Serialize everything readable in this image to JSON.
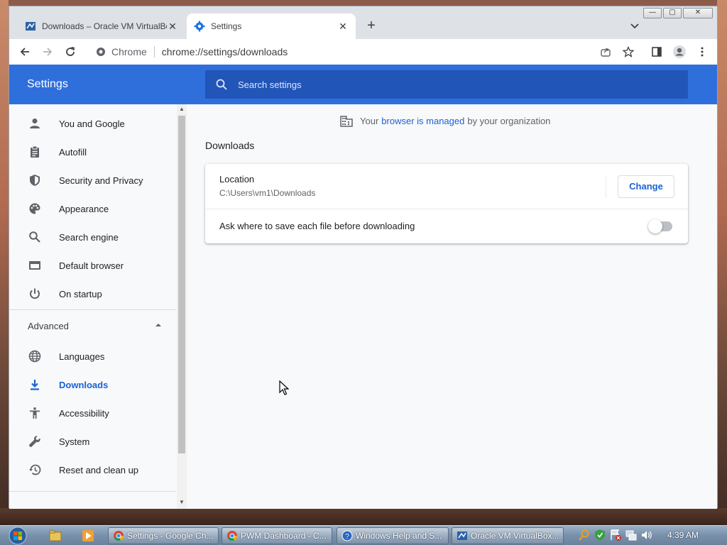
{
  "browser": {
    "tabs": [
      {
        "label": "Downloads – Oracle VM VirtualBox",
        "active": false
      },
      {
        "label": "Settings",
        "active": true
      }
    ],
    "window_controls": {
      "minimize": "—",
      "maximize": "▢",
      "close": "✕"
    },
    "omnibox": {
      "site": "Chrome",
      "url": "chrome://settings/downloads"
    }
  },
  "settings": {
    "title": "Settings",
    "search_placeholder": "Search settings",
    "managed_notice": {
      "prefix": "Your",
      "link": "browser is managed",
      "suffix": "by your organization"
    },
    "nav": [
      {
        "label": "You and Google",
        "icon": "person-icon"
      },
      {
        "label": "Autofill",
        "icon": "clipboard-icon"
      },
      {
        "label": "Security and Privacy",
        "icon": "shield-icon"
      },
      {
        "label": "Appearance",
        "icon": "palette-icon"
      },
      {
        "label": "Search engine",
        "icon": "search-icon"
      },
      {
        "label": "Default browser",
        "icon": "browser-window-icon"
      },
      {
        "label": "On startup",
        "icon": "power-icon"
      }
    ],
    "advanced_label": "Advanced",
    "advanced_nav": [
      {
        "label": "Languages",
        "icon": "globe-icon"
      },
      {
        "label": "Downloads",
        "icon": "download-icon",
        "selected": true
      },
      {
        "label": "Accessibility",
        "icon": "accessibility-icon"
      },
      {
        "label": "System",
        "icon": "wrench-icon"
      },
      {
        "label": "Reset and clean up",
        "icon": "restore-icon"
      }
    ],
    "section_title": "Downloads",
    "location_label": "Location",
    "location_value": "C:\\Users\\vm1\\Downloads",
    "change_button": "Change",
    "ask_label": "Ask where to save each file before downloading",
    "ask_enabled": false
  },
  "taskbar": {
    "items": [
      {
        "label": "Settings - Google Ch...",
        "icon": "chrome-icon"
      },
      {
        "label": "PWM Dashboard - C...",
        "icon": "chrome-icon"
      },
      {
        "label": "Windows Help and S...",
        "icon": "help-icon"
      },
      {
        "label": "Oracle VM VirtualBox...",
        "icon": "virtualbox-icon"
      }
    ],
    "clock": "4:39 AM"
  },
  "colors": {
    "accent": "#1a62d6",
    "header": "#2f6fdc",
    "search_bg": "#2255b8"
  }
}
